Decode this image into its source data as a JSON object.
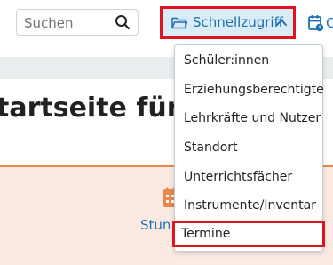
{
  "search": {
    "placeholder": "Suchen"
  },
  "quick_access": {
    "label": "Schnellzugriff",
    "items": [
      {
        "label": "Schüler:innen"
      },
      {
        "label": "Erziehungsberechtigte"
      },
      {
        "label": "Lehrkräfte und Nutzer"
      },
      {
        "label": "Standort"
      },
      {
        "label": "Unterrichtsfächer"
      },
      {
        "label": "Instrumente/Inventar"
      },
      {
        "label": "Termine"
      }
    ]
  },
  "calendar_menu": {
    "label_partial": "C"
  },
  "page": {
    "title_partial": "tartseite für L"
  },
  "card": {
    "label_partial": "Stun"
  },
  "colors": {
    "accent": "#1e6fb3",
    "highlight": "#e0141e",
    "card_bg": "#fbe9e2",
    "card_border": "#e9874d"
  }
}
